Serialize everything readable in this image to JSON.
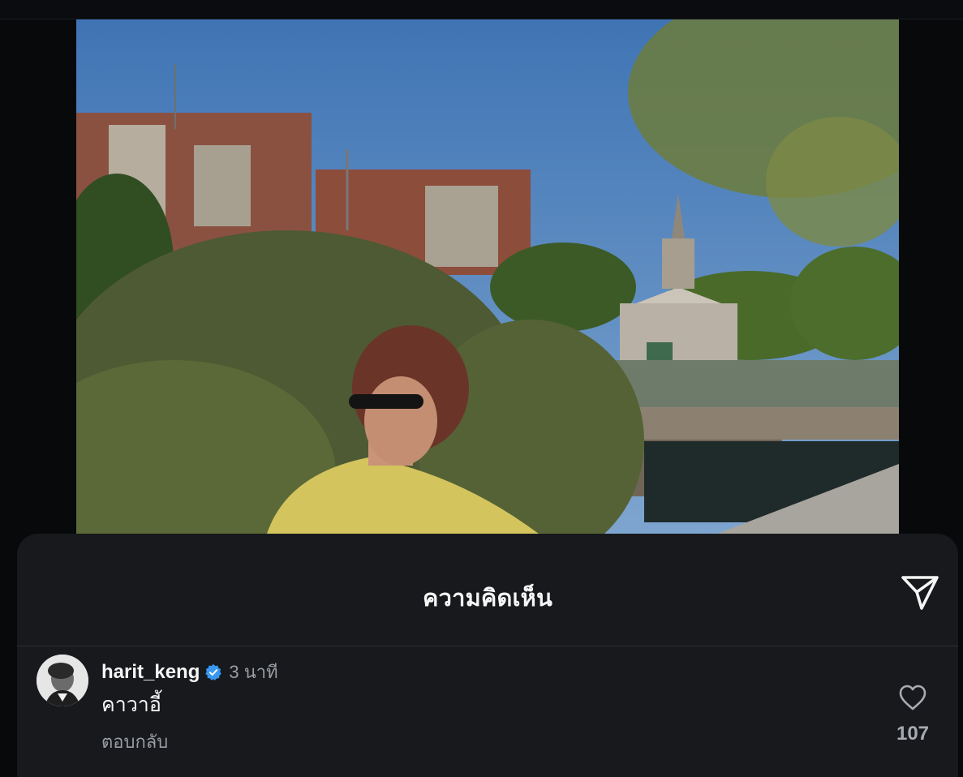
{
  "sheet": {
    "title": "ความคิดเห็น",
    "share_icon": "send-icon"
  },
  "comment": {
    "username": "harit_keng",
    "verified": true,
    "timestamp": "3 นาที",
    "text": "คาวาอี้",
    "reply_label": "ตอบกลับ",
    "like_count": "107",
    "like_icon": "heart-outline-icon"
  },
  "colors": {
    "background": "#07090b",
    "sheet": "#17191c",
    "verified": "#3897f0",
    "secondary_text": "#9a9ea4"
  }
}
